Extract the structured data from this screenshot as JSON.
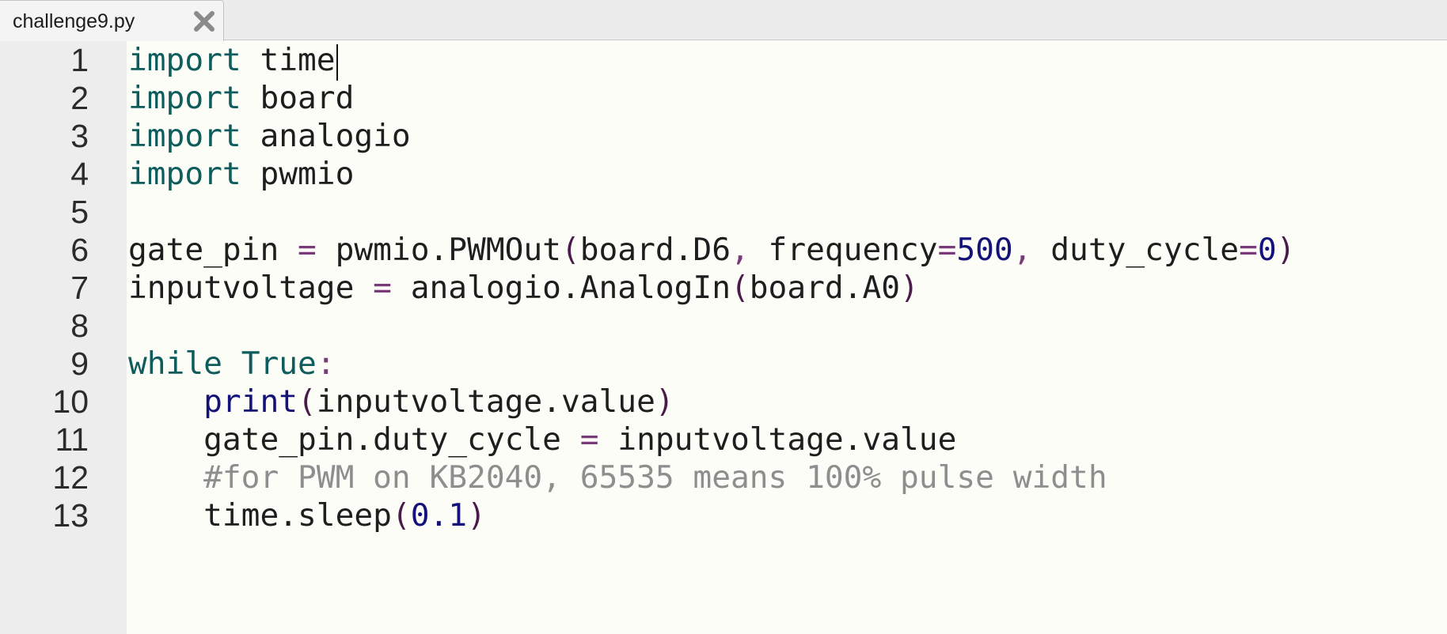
{
  "tab": {
    "filename": "challenge9.py",
    "close_icon": "close-icon"
  },
  "editor": {
    "lines": [
      {
        "number": "1",
        "tokens": [
          {
            "t": "import",
            "c": "kw"
          },
          {
            "t": " time",
            "c": ""
          }
        ],
        "caret": true
      },
      {
        "number": "2",
        "tokens": [
          {
            "t": "import",
            "c": "kw"
          },
          {
            "t": " board",
            "c": ""
          }
        ]
      },
      {
        "number": "3",
        "tokens": [
          {
            "t": "import",
            "c": "kw"
          },
          {
            "t": " analogio",
            "c": ""
          }
        ]
      },
      {
        "number": "4",
        "tokens": [
          {
            "t": "import",
            "c": "kw"
          },
          {
            "t": " pwmio",
            "c": ""
          }
        ]
      },
      {
        "number": "5",
        "tokens": []
      },
      {
        "number": "6",
        "tokens": [
          {
            "t": "gate_pin ",
            "c": ""
          },
          {
            "t": "=",
            "c": "op"
          },
          {
            "t": " pwmio.PWMOut",
            "c": ""
          },
          {
            "t": "(",
            "c": "par"
          },
          {
            "t": "board.D6",
            "c": ""
          },
          {
            "t": ",",
            "c": "op"
          },
          {
            "t": " frequency",
            "c": ""
          },
          {
            "t": "=",
            "c": "op"
          },
          {
            "t": "500",
            "c": "num"
          },
          {
            "t": ",",
            "c": "op"
          },
          {
            "t": " duty_cycle",
            "c": ""
          },
          {
            "t": "=",
            "c": "op"
          },
          {
            "t": "0",
            "c": "num"
          },
          {
            "t": ")",
            "c": "par"
          }
        ]
      },
      {
        "number": "7",
        "tokens": [
          {
            "t": "inputvoltage ",
            "c": ""
          },
          {
            "t": "=",
            "c": "op"
          },
          {
            "t": " analogio.AnalogIn",
            "c": ""
          },
          {
            "t": "(",
            "c": "par"
          },
          {
            "t": "board.A0",
            "c": ""
          },
          {
            "t": ")",
            "c": "par"
          }
        ]
      },
      {
        "number": "8",
        "tokens": []
      },
      {
        "number": "9",
        "tokens": [
          {
            "t": "while",
            "c": "kw"
          },
          {
            "t": " ",
            "c": ""
          },
          {
            "t": "True",
            "c": "kw"
          },
          {
            "t": ":",
            "c": "op"
          }
        ]
      },
      {
        "number": "10",
        "tokens": [
          {
            "t": "    ",
            "c": ""
          },
          {
            "t": "print",
            "c": "fn"
          },
          {
            "t": "(",
            "c": "par"
          },
          {
            "t": "inputvoltage.value",
            "c": ""
          },
          {
            "t": ")",
            "c": "par"
          }
        ]
      },
      {
        "number": "11",
        "tokens": [
          {
            "t": "    gate_pin.duty_cycle ",
            "c": ""
          },
          {
            "t": "=",
            "c": "op"
          },
          {
            "t": " inputvoltage.value",
            "c": ""
          }
        ]
      },
      {
        "number": "12",
        "tokens": [
          {
            "t": "    ",
            "c": ""
          },
          {
            "t": "#for PWM on KB2040, 65535 means 100% pulse width",
            "c": "cmt"
          }
        ]
      },
      {
        "number": "13",
        "tokens": [
          {
            "t": "    time.sleep",
            "c": ""
          },
          {
            "t": "(",
            "c": "par"
          },
          {
            "t": "0.1",
            "c": "num"
          },
          {
            "t": ")",
            "c": "par"
          }
        ]
      }
    ]
  }
}
